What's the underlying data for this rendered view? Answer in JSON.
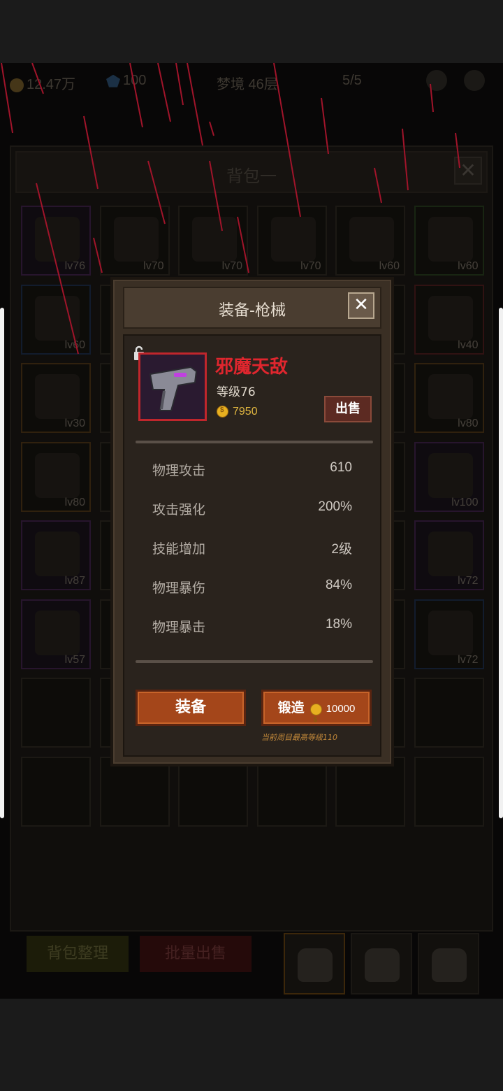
{
  "hud": {
    "gold": "12.47万",
    "gems": "100",
    "stage": "梦境 46层",
    "keys": "5/5"
  },
  "bag": {
    "title": "背包一",
    "close_glyph": "✕",
    "sort_label": "背包整理",
    "bulk_sell_label": "批量出售",
    "slots": [
      {
        "level": "lv76",
        "rarity": "purple"
      },
      {
        "level": "lv70",
        "rarity": "neutral"
      },
      {
        "level": "lv70",
        "rarity": "neutral"
      },
      {
        "level": "lv70",
        "rarity": "neutral"
      },
      {
        "level": "lv60",
        "rarity": "neutral"
      },
      {
        "level": "lv60",
        "rarity": "green"
      },
      {
        "level": "lv60",
        "rarity": "blue"
      },
      {
        "level": "",
        "rarity": "neutral"
      },
      {
        "level": "",
        "rarity": "neutral"
      },
      {
        "level": "",
        "rarity": "neutral"
      },
      {
        "level": "",
        "rarity": "neutral"
      },
      {
        "level": "lv40",
        "rarity": "red"
      },
      {
        "level": "lv30",
        "rarity": "orange"
      },
      {
        "level": "",
        "rarity": "neutral"
      },
      {
        "level": "",
        "rarity": "neutral"
      },
      {
        "level": "",
        "rarity": "neutral"
      },
      {
        "level": "",
        "rarity": "neutral"
      },
      {
        "level": "lv80",
        "rarity": "orange"
      },
      {
        "level": "lv80",
        "rarity": "orange"
      },
      {
        "level": "",
        "rarity": "neutral"
      },
      {
        "level": "",
        "rarity": "neutral"
      },
      {
        "level": "",
        "rarity": "neutral"
      },
      {
        "level": "",
        "rarity": "neutral"
      },
      {
        "level": "lv100",
        "rarity": "purple"
      },
      {
        "level": "lv87",
        "rarity": "purple"
      },
      {
        "level": "",
        "rarity": "neutral"
      },
      {
        "level": "",
        "rarity": "neutral"
      },
      {
        "level": "",
        "rarity": "neutral"
      },
      {
        "level": "",
        "rarity": "neutral"
      },
      {
        "level": "lv72",
        "rarity": "purple"
      },
      {
        "level": "lv57",
        "rarity": "purple"
      },
      {
        "level": "",
        "rarity": "neutral"
      },
      {
        "level": "",
        "rarity": "neutral"
      },
      {
        "level": "",
        "rarity": "neutral"
      },
      {
        "level": "",
        "rarity": "neutral"
      },
      {
        "level": "lv72",
        "rarity": "blue"
      },
      {
        "level": "",
        "rarity": "empty"
      },
      {
        "level": "",
        "rarity": "empty"
      },
      {
        "level": "",
        "rarity": "empty"
      },
      {
        "level": "",
        "rarity": "empty"
      },
      {
        "level": "",
        "rarity": "empty"
      },
      {
        "level": "",
        "rarity": "empty"
      },
      {
        "level": "",
        "rarity": "empty"
      },
      {
        "level": "",
        "rarity": "empty"
      },
      {
        "level": "",
        "rarity": "empty"
      },
      {
        "level": "",
        "rarity": "empty"
      },
      {
        "level": "",
        "rarity": "empty"
      },
      {
        "level": "",
        "rarity": "empty"
      }
    ]
  },
  "dialog": {
    "title": "装备-枪械",
    "close_glyph": "✕",
    "item": {
      "name": "邪魔天敌",
      "level": "等级76",
      "price": "7950"
    },
    "sell_label": "出售",
    "stats": [
      {
        "label": "物理攻击",
        "value": "610"
      },
      {
        "label": "攻击强化",
        "value": "200%"
      },
      {
        "label": "技能增加",
        "value": "2级"
      },
      {
        "label": "物理暴伤",
        "value": "84%"
      },
      {
        "label": "物理暴击",
        "value": "18%"
      }
    ],
    "equip_label": "装备",
    "forge_label": "锻造",
    "forge_cost": "10000",
    "forge_note": "当前周目最高等级110"
  },
  "colors": {
    "item_name": "#e0262e",
    "button_orange": "#a4461a",
    "gold": "#e0b640"
  }
}
